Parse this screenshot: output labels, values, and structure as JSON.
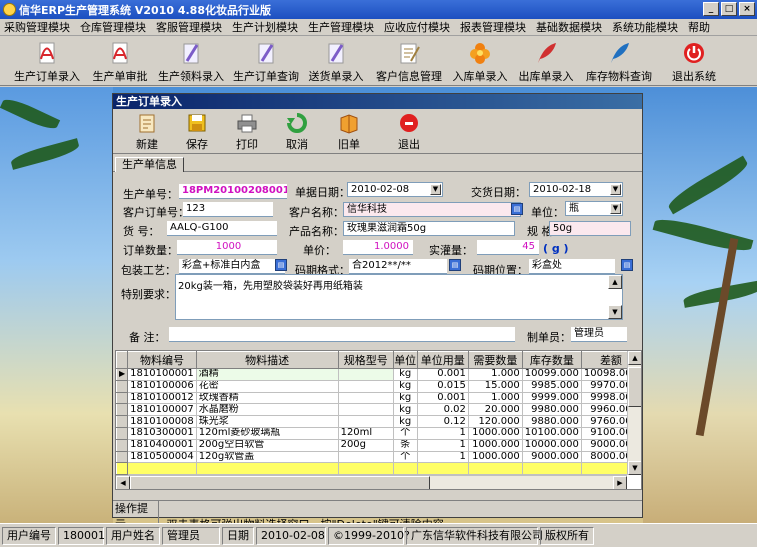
{
  "window": {
    "title": "信华ERP生产管理系统  V2010 4.88化妆品行业版",
    "minimize": "_",
    "maximize": "□",
    "close": "×"
  },
  "menu": [
    "采购管理模块",
    "仓库管理模块",
    "客服管理模块",
    "生产计划模块",
    "生产管理模块",
    "应收应付模块",
    "报表管理模块",
    "基础数据模块",
    "系统功能模块",
    "帮助"
  ],
  "main_toolbar": [
    {
      "label": "生产订单录入",
      "icon": "pdf-icon",
      "color": "#d8262c"
    },
    {
      "label": "生产单审批",
      "icon": "pdf-icon",
      "color": "#d8262c"
    },
    {
      "label": "生产领料录入",
      "icon": "feather-doc-icon",
      "color": "#7c5cc8"
    },
    {
      "label": "生产订单查询",
      "icon": "feather-doc-icon",
      "color": "#7c5cc8"
    },
    {
      "label": "送货单录入",
      "icon": "feather-doc-icon",
      "color": "#7c5cc8"
    },
    {
      "label": "客户信息管理",
      "icon": "edit-doc-icon",
      "color": "#a08040"
    },
    {
      "label": "入库单录入",
      "icon": "flower-icon",
      "color": "#f08010"
    },
    {
      "label": "出库单录入",
      "icon": "quill-icon",
      "color": "#d03030"
    },
    {
      "label": "库存物料查询",
      "icon": "quill-icon",
      "color": "#2070c0"
    },
    {
      "label": "退出系统",
      "icon": "power-icon",
      "color": "#e02020"
    }
  ],
  "child": {
    "title": "生产订单录入",
    "toolbar": [
      {
        "label": "新建",
        "icon": "new-doc-icon",
        "color": "#e0b060"
      },
      {
        "label": "保存",
        "icon": "save-icon",
        "color": "#f0c020"
      },
      {
        "label": "打印",
        "icon": "printer-icon",
        "color": "#707070"
      },
      {
        "label": "取消",
        "icon": "undo-icon",
        "color": "#30a040"
      },
      {
        "label": "旧单",
        "icon": "book-icon",
        "color": "#e08020"
      },
      {
        "label": "退出",
        "icon": "exit-icon",
        "color": "#e02020"
      }
    ],
    "tab": "生产单信息",
    "form": {
      "order_no_label": "生产单号：",
      "order_no": "18PM20100208001",
      "doc_date_label": "单据日期：",
      "doc_date": "2010-02-08",
      "delivery_date_label": "交货日期：",
      "delivery_date": "2010-02-18",
      "cust_order_label": "客户订单号：",
      "cust_order": "123",
      "cust_name_label": "客户名称：",
      "cust_name": "信华科技",
      "unit_label": "单位：",
      "unit": "瓶",
      "item_no_label": "货  号：",
      "item_no": "AALQ-G100",
      "product_label": "产品名称：",
      "product": "玫瑰果滋润霜50g",
      "spec_label": "规  格：",
      "spec": "50g",
      "qty_label": "订单数量：",
      "qty": "1000",
      "price_label": "单价：",
      "price": "1.0000",
      "fill_label": "实灌量：",
      "fill": "45",
      "fill_unit": "( g )",
      "pack_label": "包装工艺：",
      "pack": "彩盒+标准白内盒",
      "code_fmt_label": "码期格式：",
      "code_fmt": "合2012**/**",
      "code_pos_label": "码期位置：",
      "code_pos": "彩盒处",
      "special_label": "特别要求：",
      "special": "20kg装一箱，先用塑胶袋装好再用纸箱装",
      "remark_label": "备  注：",
      "remark": "",
      "maker_label": "制单员：",
      "maker": "管理员"
    },
    "grid": {
      "columns": [
        "物料编号",
        "物料描述",
        "规格型号",
        "单位",
        "单位用量",
        "需要数量",
        "库存数量",
        "差额"
      ],
      "rows": [
        [
          "1810100001",
          "酒精",
          "",
          "kg",
          "0.001",
          "1.000",
          "10099.000",
          "10098.000"
        ],
        [
          "1810100006",
          "花密",
          "",
          "kg",
          "0.015",
          "15.000",
          "9985.000",
          "9970.000"
        ],
        [
          "1810100012",
          "玫瑰香精",
          "",
          "kg",
          "0.001",
          "1.000",
          "9999.000",
          "9998.000"
        ],
        [
          "1810100007",
          "水晶磨粉",
          "",
          "kg",
          "0.02",
          "20.000",
          "9980.000",
          "9960.000"
        ],
        [
          "1810100008",
          "珠光浆",
          "",
          "kg",
          "0.12",
          "120.000",
          "9880.000",
          "9760.000"
        ],
        [
          "1810300001",
          "120ml菱砂玻璃瓶",
          "120ml",
          "个",
          "1",
          "1000.000",
          "10100.000",
          "9100.000"
        ],
        [
          "1810400001",
          "200g空白软管",
          "200g",
          "条",
          "1",
          "1000.000",
          "10000.000",
          "9000.000"
        ],
        [
          "1810500004",
          "120g软管盖",
          "",
          "个",
          "1",
          "1000.000",
          "9000.000",
          "8000.000"
        ]
      ]
    },
    "hint_label": "操作提示",
    "hint": "双击表格可弹出物料选择窗口，按\"Delete\"键可清除内容。"
  },
  "status": {
    "user_no_label": "用户编号",
    "user_no": "180001",
    "user_name_label": "用户姓名",
    "user_name": "管理员",
    "date_label": "日期",
    "date": "2010-02-08",
    "copyright": "©1999-2010?",
    "company": "广东信华软件科技有限公司",
    "rights": "版权所有"
  }
}
